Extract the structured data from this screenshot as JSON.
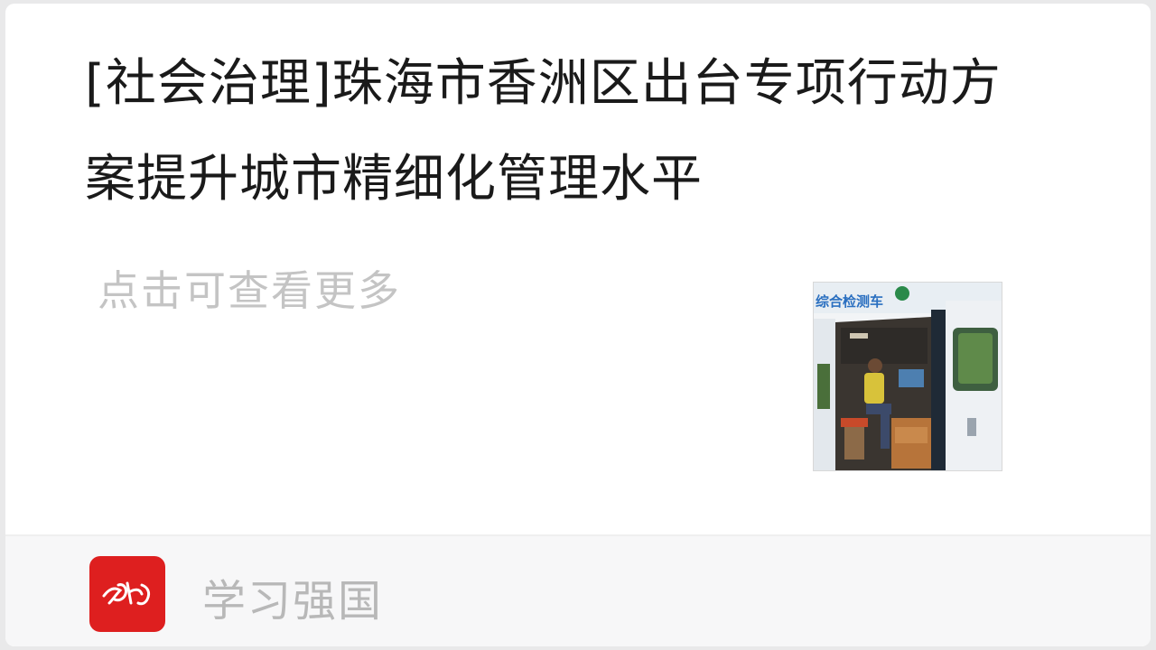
{
  "card": {
    "title": "[社会治理]珠海市香洲区出台专项行动方案提升城市精细化管理水平",
    "more_label": "点击可查看更多",
    "thumbnail_text": "综合检测车"
  },
  "footer": {
    "source_name": "学习强国",
    "logo_icon": "xuexi-qiangguo-logo-icon",
    "logo_color": "#de1f1f"
  }
}
